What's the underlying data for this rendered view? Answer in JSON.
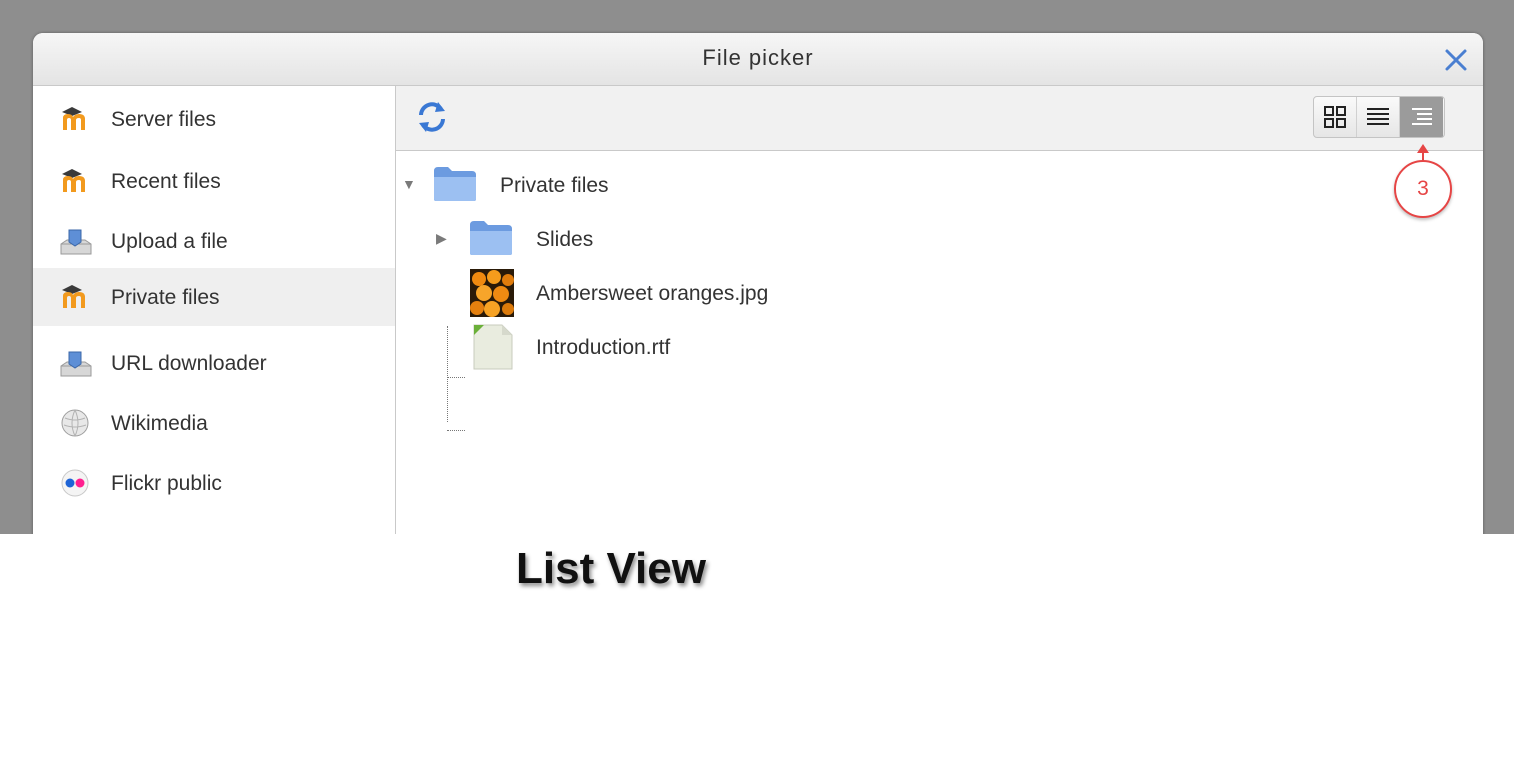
{
  "dialog": {
    "title": "File picker"
  },
  "sidebar": {
    "items": [
      {
        "label": "Server files",
        "icon": "moodle-icon",
        "active": false
      },
      {
        "label": "Recent files",
        "icon": "moodle-icon",
        "active": false
      },
      {
        "label": "Upload a file",
        "icon": "upload-icon",
        "active": false
      },
      {
        "label": "Private files",
        "icon": "moodle-icon",
        "active": true
      },
      {
        "label": "URL downloader",
        "icon": "download-icon",
        "active": false
      },
      {
        "label": "Wikimedia",
        "icon": "wikimedia-globe-icon",
        "active": false
      },
      {
        "label": "Flickr public",
        "icon": "flickr-icon",
        "active": false
      }
    ]
  },
  "toolbar": {
    "refresh_icon": "refresh-icon",
    "views": [
      {
        "name": "icons",
        "icon": "grid-view-icon",
        "active": false
      },
      {
        "name": "details",
        "icon": "list-view-icon",
        "active": false
      },
      {
        "name": "tree",
        "icon": "tree-view-icon",
        "active": true
      }
    ]
  },
  "tree": {
    "root": {
      "label": "Private files",
      "icon": "folder-icon",
      "expanded": true
    },
    "children": [
      {
        "label": "Slides",
        "icon": "folder-icon",
        "type": "folder",
        "expanded": false
      },
      {
        "label": "Ambersweet oranges.jpg",
        "icon": "image-thumbnail-icon",
        "type": "file"
      },
      {
        "label": "Introduction.rtf",
        "icon": "document-icon",
        "type": "file"
      }
    ]
  },
  "annotation": {
    "marker": "3",
    "color": "#e64545"
  },
  "caption": "List View",
  "colors": {
    "backdrop": "#8e8e8e",
    "accent_blue": "#4a7fd1",
    "moodle_orange": "#f29a1e"
  }
}
